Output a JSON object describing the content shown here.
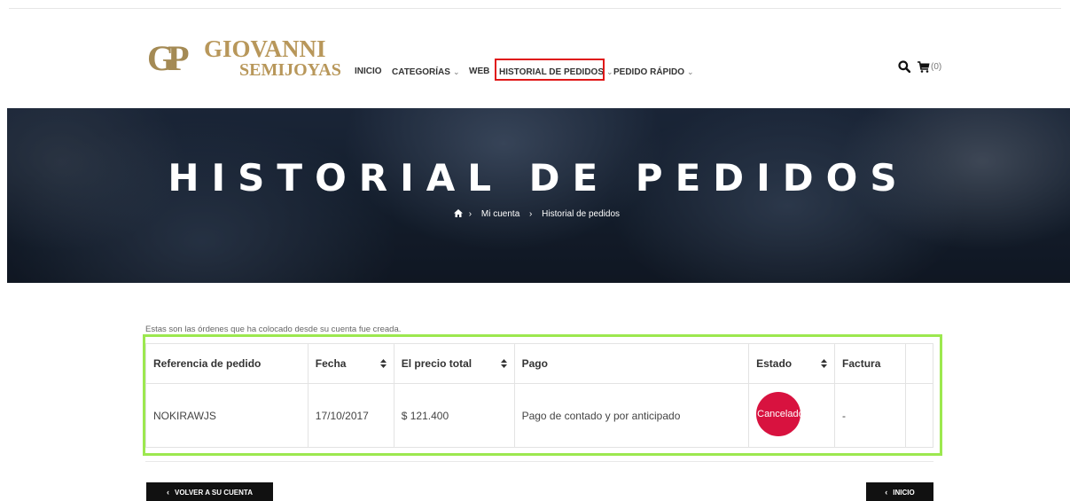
{
  "brand": {
    "monogram": "GP",
    "name": "GIOVANNI",
    "subtitle": "SEMIJOYAS"
  },
  "nav": {
    "items": [
      {
        "label": "INICIO",
        "has_dropdown": false
      },
      {
        "label": "CATEGORÍAS",
        "has_dropdown": true
      },
      {
        "label": "WEB",
        "has_dropdown": false
      },
      {
        "label": "HISTORIAL DE PEDIDOS",
        "has_dropdown": true
      },
      {
        "label": "PEDIDO RÁPIDO",
        "has_dropdown": true
      }
    ],
    "cart_count": "(0)",
    "highlight_color": "#e01818"
  },
  "banner": {
    "title": "HISTORIAL DE PEDIDOS",
    "breadcrumb": {
      "separator": "›",
      "items": [
        "Mi cuenta",
        "Historial de pedidos"
      ]
    }
  },
  "content": {
    "intro": "Estas son las órdenes que ha colocado desde su cuenta fue creada.",
    "frame_color": "#9ce84f",
    "table": {
      "headers": [
        "Referencia de pedido",
        "Fecha",
        "El precio total",
        "Pago",
        "Estado",
        "Factura"
      ],
      "rows": [
        {
          "reference": "NOKIRAWJS",
          "date": "17/10/2017",
          "total": "$ 121.400",
          "payment": "Pago de contado y por anticipado",
          "status": "Cancelado",
          "status_color": "#d8123f",
          "invoice": "-"
        }
      ]
    }
  },
  "buttons": {
    "back": "VOLVER A SU CUENTA",
    "home": "INICIO"
  }
}
